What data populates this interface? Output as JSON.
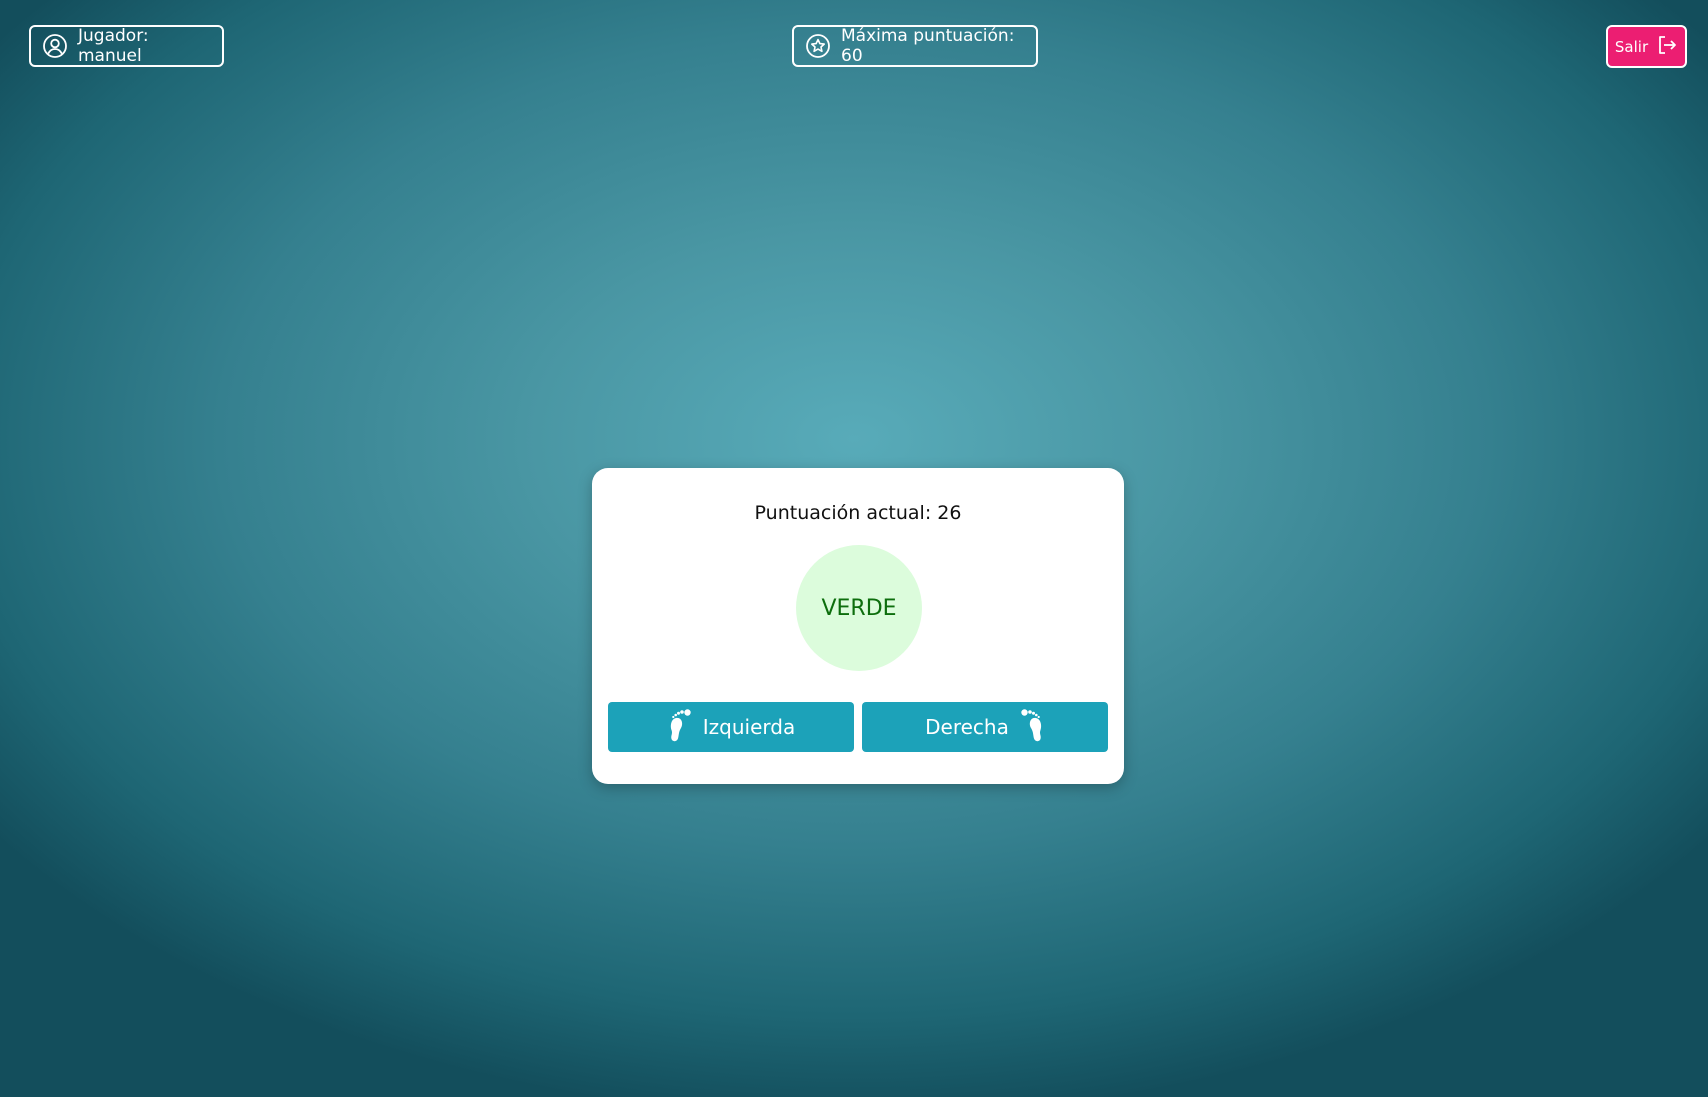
{
  "header": {
    "player_label": "Jugador: manuel",
    "player_icon": "user-circle-icon",
    "best_score_label": "Máxima puntuación: 60",
    "best_score_icon": "star-circle-icon",
    "exit_label": "Salir",
    "exit_icon": "logout-icon"
  },
  "game": {
    "current_score_label": "Puntuación actual: 26",
    "color_word": "VERDE",
    "color_word_text_color": "#0d6e0d",
    "color_word_bg_color": "#dcfcdc",
    "left_button_label": "Izquierda",
    "left_button_icon": "left-foot-icon",
    "right_button_label": "Derecha",
    "right_button_icon": "right-foot-icon"
  },
  "colors": {
    "accent": "#1ca2b9",
    "exit_button": "#ec1e72",
    "card_background": "#ffffff"
  }
}
